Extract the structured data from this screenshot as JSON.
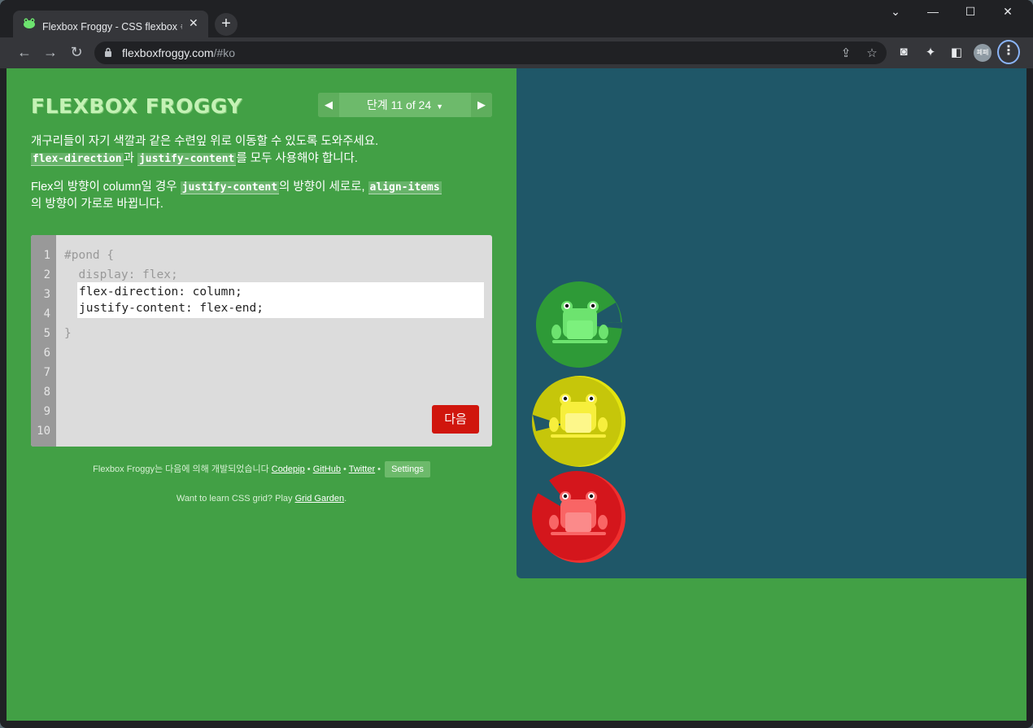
{
  "browser": {
    "tab_title": "Flexbox Froggy - CSS flexbox 속",
    "tab_close": "✕",
    "new_tab": "+",
    "url_host": "flexboxfroggy.com",
    "url_path": "/#ko",
    "avatar": "폐폐",
    "icons": [
      "back-icon",
      "forward-icon",
      "reload-icon",
      "lock-icon",
      "share-icon",
      "star-icon",
      "camera-icon",
      "extensions-icon",
      "sidepanel-icon",
      "menu-icon"
    ]
  },
  "game": {
    "title": "FLEXBOX FROGGY",
    "level_label": "단계 11 of 24",
    "instructions_1": {
      "line1": "개구리들이 자기 색깔과 같은 수련잎 위로 이동할 수 있도록 도와주세요.",
      "kw1": "flex-direction",
      "mid": "과 ",
      "kw2": "justify-content",
      "tail": "를 모두 사용해야 합니다."
    },
    "instructions_2": {
      "head": "Flex의 방향이 column일 경우 ",
      "kw1": "justify-content",
      "mid": "의 방향이 세로로, ",
      "kw2": "align-items",
      "tail": "의 방향이 가로로 바뀝니다."
    },
    "editor": {
      "line_numbers": [
        "1",
        "2",
        "3",
        "4",
        "5",
        "6",
        "7",
        "8",
        "9",
        "10"
      ],
      "line1": "#pond {",
      "line2": "  display: flex;",
      "answer": "flex-direction: column;\njustify-content: flex-end;",
      "line5": "}",
      "next_button": "다음"
    },
    "credits": {
      "prefix": "Flexbox Froggy는 다음에 의해 개발되었습니다 ",
      "codepip": "Codepip",
      "github": "GitHub",
      "twitter": "Twitter",
      "sep": " • ",
      "settings": "Settings"
    },
    "grid_promo": {
      "text": "Want to learn CSS grid? Play ",
      "link": "Grid Garden",
      "end": "."
    },
    "frogs": [
      {
        "color": "green",
        "pad": "#2e9a37",
        "frog": "#6de36f"
      },
      {
        "color": "yellow",
        "pad": "#c6c60a",
        "frog": "#fbf055"
      },
      {
        "color": "red",
        "pad": "#d4161c",
        "frog": "#f96565"
      }
    ]
  }
}
